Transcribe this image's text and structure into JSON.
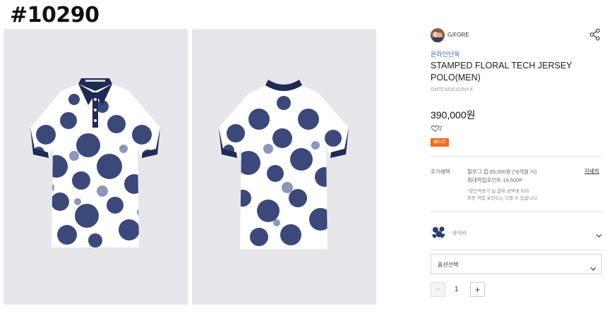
{
  "overlay_id": "#10290",
  "gallery": {
    "images": [
      {
        "view": "front",
        "shirt_color": "#ffffff",
        "pattern_color": "#2a3a6e",
        "collar_color": "#1f2a55"
      },
      {
        "view": "back",
        "shirt_color": "#ffffff",
        "pattern_color": "#2a3a6e",
        "collar_color": "#1f2a55"
      }
    ],
    "background_color": "#e6e6eb"
  },
  "product": {
    "brand_name": "G/FORE",
    "online_exclusive": "온라인단독",
    "title": "STAMPED FLORAL TECH JERSEY POLO(MEN)",
    "code": "GMTCM26102NYX",
    "price": "390,000원",
    "like_count": "2",
    "best_tag": "베스트",
    "accent_color": "#f36b21",
    "link_color": "#3a63b8"
  },
  "benefits": {
    "label": "추가혜택",
    "line1": "할부그 칩 65,000원 (*6개월 시)",
    "line2": "최대적립포인트 19,500P",
    "note1": "*할인적용가 실 결제 금액에 따라",
    "note2": "최종 적립 포인트는 다를 수 있습니다.",
    "detail_link": "자세히"
  },
  "color_option": {
    "name": "네이비",
    "icon": "chevron-down-icon"
  },
  "option_select": {
    "placeholder": "옵션선택",
    "icon": "chevron-down-icon"
  },
  "quantity": {
    "minus": "−",
    "value": "1",
    "plus": "+"
  }
}
